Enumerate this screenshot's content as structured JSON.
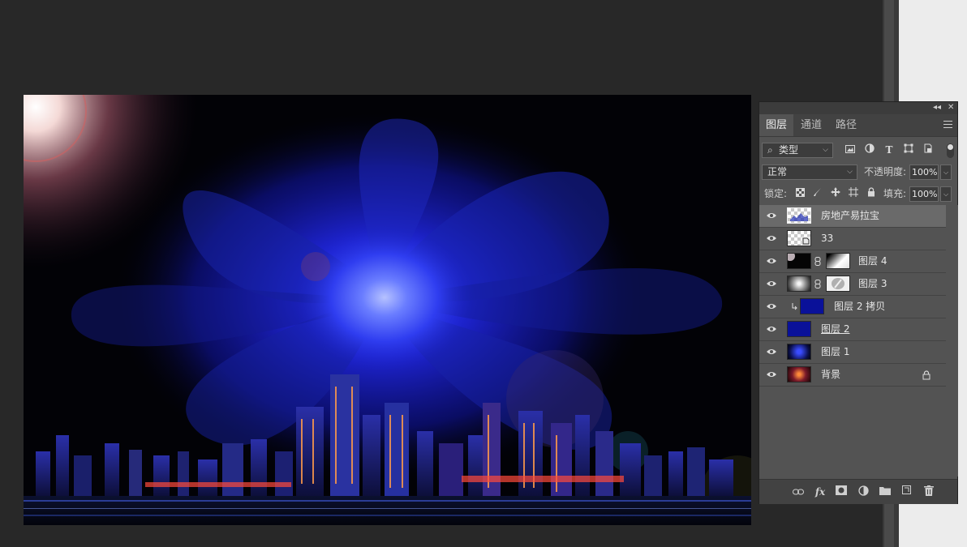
{
  "panel": {
    "tabs": [
      {
        "label": "图层",
        "active": true
      },
      {
        "label": "通道",
        "active": false
      },
      {
        "label": "路径",
        "active": false
      }
    ],
    "filter": {
      "kind_label": "类型",
      "icons": [
        "image-filter-icon",
        "adjustment-filter-icon",
        "type-filter-icon",
        "shape-filter-icon",
        "smart-object-filter-icon"
      ]
    },
    "blend_mode": "正常",
    "opacity": {
      "label": "不透明度:",
      "value": "100%"
    },
    "lock": {
      "label": "锁定:"
    },
    "fill": {
      "label": "填充:",
      "value": "100%"
    },
    "layers": [
      {
        "name": "房地产易拉宝",
        "selected": true,
        "type": "smart-object"
      },
      {
        "name": "33",
        "selected": false,
        "type": "smart-object"
      },
      {
        "name": "图层 4",
        "selected": false,
        "type": "masked"
      },
      {
        "name": "图层 3",
        "selected": false,
        "type": "masked"
      },
      {
        "name": "图层 2 拷贝",
        "selected": false,
        "type": "clipped-fill"
      },
      {
        "name": "图层 2",
        "selected": false,
        "type": "fill"
      },
      {
        "name": "图层 1",
        "selected": false,
        "type": "image"
      },
      {
        "name": "背景",
        "selected": false,
        "type": "background",
        "locked": true
      }
    ],
    "footer_icons": [
      "link-layers-icon",
      "fx-icon",
      "add-mask-icon",
      "adjustment-layer-icon",
      "new-group-icon",
      "new-layer-icon",
      "delete-layer-icon"
    ]
  },
  "colors": {
    "workspace": "#282828",
    "panel": "#535353",
    "selected_layer": "#6a6a6a",
    "layer_blue": "#0a1199"
  }
}
